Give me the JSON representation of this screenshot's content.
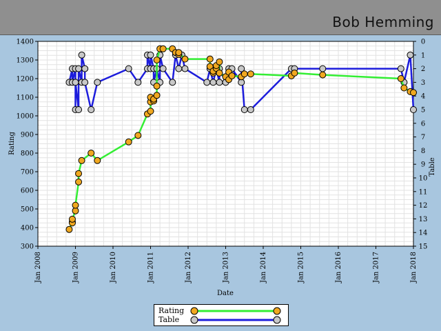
{
  "header": {
    "player_name": "Bob Hemming"
  },
  "colors": {
    "rating_line": "#33ee33",
    "rating_marker": "#f0a820",
    "table_line": "#1c1cdc",
    "table_marker": "#c8c8c8",
    "plot_bg": "#ffffff",
    "frame_bg": "#a8c6df"
  },
  "chart_data": {
    "type": "line",
    "title": "",
    "xlabel": "Date",
    "ylabel": "Rating",
    "y2label": "Table",
    "x_ticks": [
      "Jan 2008",
      "Jan 2009",
      "Jan 2010",
      "Jan 2011",
      "Jan 2012",
      "Jan 2013",
      "Jan 2014",
      "Jan 2015",
      "Jan 2016",
      "Jan 2017",
      "Jan 2018"
    ],
    "xlim": [
      "2008-01",
      "2018-01"
    ],
    "ylim": [
      300,
      1400
    ],
    "y_ticks": [
      300,
      400,
      500,
      600,
      700,
      800,
      900,
      1000,
      1100,
      1200,
      1300,
      1400
    ],
    "y2lim": [
      0,
      15
    ],
    "y2_ticks": [
      0,
      1,
      2,
      3,
      4,
      5,
      6,
      7,
      8,
      9,
      10,
      11,
      12,
      13,
      14,
      15
    ],
    "y2_inverted": true,
    "grid": true,
    "legend_position": "bottom-center",
    "series": [
      {
        "name": "Rating",
        "axis": "left",
        "points": [
          [
            "2008-11",
            390
          ],
          [
            "2008-12",
            430
          ],
          [
            "2008-12",
            425
          ],
          [
            "2008-12",
            445
          ],
          [
            "2009-01",
            490
          ],
          [
            "2009-01",
            520
          ],
          [
            "2009-02",
            645
          ],
          [
            "2009-02",
            690
          ],
          [
            "2009-03",
            760
          ],
          [
            "2009-06",
            800
          ],
          [
            "2009-08",
            760
          ],
          [
            "2010-06",
            860
          ],
          [
            "2010-09",
            895
          ],
          [
            "2010-12",
            1010
          ],
          [
            "2011-01",
            1025
          ],
          [
            "2011-01",
            1075
          ],
          [
            "2011-01",
            1100
          ],
          [
            "2011-02",
            1080
          ],
          [
            "2011-02",
            1090
          ],
          [
            "2011-03",
            1110
          ],
          [
            "2011-03",
            1160
          ],
          [
            "2011-03",
            1300
          ],
          [
            "2011-04",
            1360
          ],
          [
            "2011-05",
            1360
          ],
          [
            "2011-08",
            1360
          ],
          [
            "2011-09",
            1340
          ],
          [
            "2011-10",
            1330
          ],
          [
            "2011-10",
            1340
          ],
          [
            "2011-12",
            1305
          ],
          [
            "2012-08",
            1305
          ],
          [
            "2012-08",
            1265
          ],
          [
            "2012-09",
            1230
          ],
          [
            "2012-09",
            1240
          ],
          [
            "2012-10",
            1255
          ],
          [
            "2012-10",
            1270
          ],
          [
            "2012-11",
            1290
          ],
          [
            "2012-11",
            1230
          ],
          [
            "2013-01",
            1210
          ],
          [
            "2013-02",
            1195
          ],
          [
            "2013-02",
            1235
          ],
          [
            "2013-03",
            1215
          ],
          [
            "2013-06",
            1210
          ],
          [
            "2013-07",
            1225
          ],
          [
            "2013-09",
            1225
          ],
          [
            "2014-10",
            1215
          ],
          [
            "2014-11",
            1230
          ],
          [
            "2015-08",
            1220
          ],
          [
            "2017-09",
            1200
          ],
          [
            "2017-10",
            1150
          ],
          [
            "2017-12",
            1130
          ],
          [
            "2018-01",
            1125
          ]
        ]
      },
      {
        "name": "Table",
        "axis": "right",
        "points": [
          [
            "2008-11",
            3
          ],
          [
            "2008-12",
            2
          ],
          [
            "2008-12",
            3
          ],
          [
            "2009-01",
            2
          ],
          [
            "2009-01",
            5
          ],
          [
            "2009-01",
            3
          ],
          [
            "2009-02",
            5
          ],
          [
            "2009-02",
            2
          ],
          [
            "2009-03",
            3
          ],
          [
            "2009-03",
            1
          ],
          [
            "2009-04",
            2
          ],
          [
            "2009-04",
            3
          ],
          [
            "2009-06",
            5
          ],
          [
            "2009-08",
            3
          ],
          [
            "2010-06",
            2
          ],
          [
            "2010-09",
            3
          ],
          [
            "2010-12",
            2
          ],
          [
            "2010-12",
            1
          ],
          [
            "2011-01",
            2
          ],
          [
            "2011-01",
            1
          ],
          [
            "2011-02",
            2
          ],
          [
            "2011-02",
            3
          ],
          [
            "2011-03",
            2
          ],
          [
            "2011-04",
            3
          ],
          [
            "2011-04",
            1
          ],
          [
            "2011-05",
            2
          ],
          [
            "2011-08",
            3
          ],
          [
            "2011-09",
            1
          ],
          [
            "2011-10",
            2
          ],
          [
            "2011-11",
            1
          ],
          [
            "2011-12",
            2
          ],
          [
            "2012-07",
            3
          ],
          [
            "2012-08",
            2
          ],
          [
            "2012-09",
            3
          ],
          [
            "2012-10",
            2
          ],
          [
            "2012-11",
            3
          ],
          [
            "2012-11",
            2
          ],
          [
            "2013-01",
            3
          ],
          [
            "2013-02",
            2
          ],
          [
            "2013-03",
            2
          ],
          [
            "2013-06",
            3
          ],
          [
            "2013-06",
            2
          ],
          [
            "2013-07",
            5
          ],
          [
            "2013-09",
            5
          ],
          [
            "2014-10",
            2
          ],
          [
            "2014-11",
            2
          ],
          [
            "2015-08",
            2
          ],
          [
            "2017-09",
            2
          ],
          [
            "2017-10",
            3
          ],
          [
            "2017-12",
            1
          ],
          [
            "2018-01",
            5
          ]
        ]
      }
    ]
  }
}
